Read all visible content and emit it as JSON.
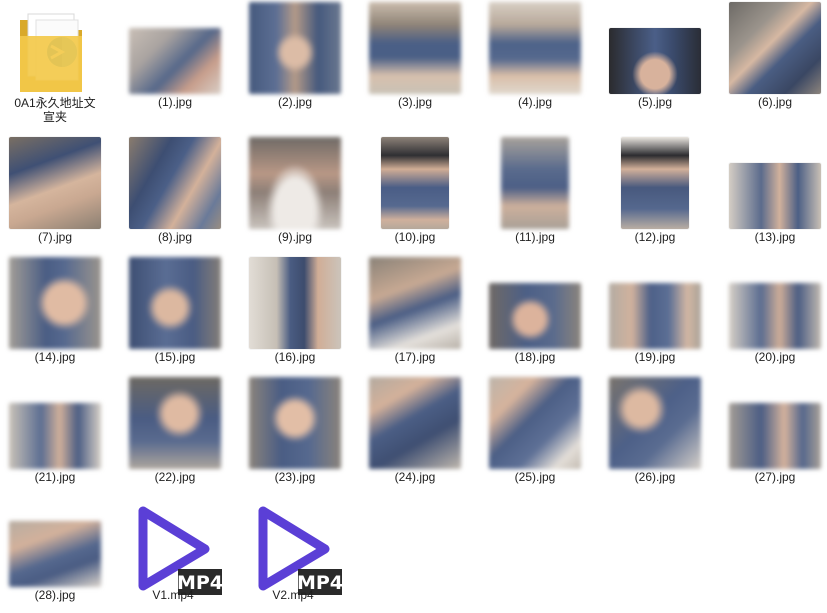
{
  "window": {
    "title": ""
  },
  "items": [
    {
      "name": "0A1永久地址文宣夹",
      "kind": "folder",
      "icon": "folder-icon",
      "label_line1": "0A1永久地址文",
      "label_line2": "宣夹"
    },
    {
      "name": "(1).jpg",
      "kind": "image"
    },
    {
      "name": "(2).jpg",
      "kind": "image"
    },
    {
      "name": "(3).jpg",
      "kind": "image"
    },
    {
      "name": "(4).jpg",
      "kind": "image"
    },
    {
      "name": "(5).jpg",
      "kind": "image"
    },
    {
      "name": "(6).jpg",
      "kind": "image"
    },
    {
      "name": "(7).jpg",
      "kind": "image"
    },
    {
      "name": "(8).jpg",
      "kind": "image"
    },
    {
      "name": "(9).jpg",
      "kind": "image"
    },
    {
      "name": "(10).jpg",
      "kind": "image"
    },
    {
      "name": "(11).jpg",
      "kind": "image"
    },
    {
      "name": "(12).jpg",
      "kind": "image"
    },
    {
      "name": "(13).jpg",
      "kind": "image"
    },
    {
      "name": "(14).jpg",
      "kind": "image"
    },
    {
      "name": "(15).jpg",
      "kind": "image"
    },
    {
      "name": "(16).jpg",
      "kind": "image"
    },
    {
      "name": "(17).jpg",
      "kind": "image"
    },
    {
      "name": "(18).jpg",
      "kind": "image"
    },
    {
      "name": "(19).jpg",
      "kind": "image"
    },
    {
      "name": "(20).jpg",
      "kind": "image"
    },
    {
      "name": "(21).jpg",
      "kind": "image"
    },
    {
      "name": "(22).jpg",
      "kind": "image"
    },
    {
      "name": "(23).jpg",
      "kind": "image"
    },
    {
      "name": "(24).jpg",
      "kind": "image"
    },
    {
      "name": "(25).jpg",
      "kind": "image"
    },
    {
      "name": "(26).jpg",
      "kind": "image"
    },
    {
      "name": "(27).jpg",
      "kind": "image"
    },
    {
      "name": "(28).jpg",
      "kind": "image"
    },
    {
      "name": "V1.mp4",
      "kind": "video",
      "icon": "mp4-icon",
      "badge": "MP4"
    },
    {
      "name": "V2.mp4",
      "kind": "video",
      "icon": "mp4-icon",
      "badge": "MP4"
    }
  ],
  "colors": {
    "folder_yellow": "#f3c94a",
    "folder_dark": "#d9a92a",
    "globe_blue": "#2a8fd6",
    "mp4_purple": "#5b3fd6",
    "mp4_badge_bg": "#2a2a2a",
    "thumb_blue": "#41577f",
    "thumb_skin": "#c9a891",
    "thumb_bg": "#d7d4cf"
  }
}
